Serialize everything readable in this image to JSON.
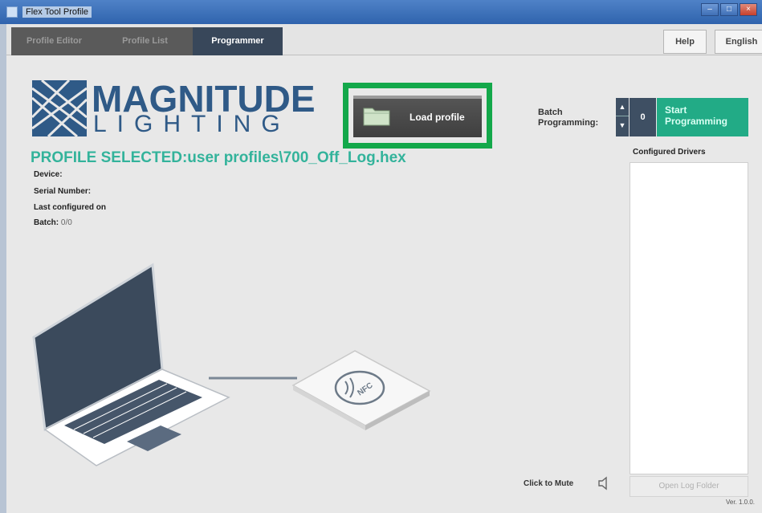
{
  "window": {
    "title": "Flex Tool Profile",
    "controls": [
      "–",
      "□",
      "×"
    ]
  },
  "tabs": [
    {
      "label": "Profile Editor",
      "active": false
    },
    {
      "label": "Profile List",
      "active": false
    },
    {
      "label": "Programmer",
      "active": true
    }
  ],
  "header": {
    "help_label": "Help",
    "language_label": "English"
  },
  "logo": {
    "line1": "MAGNITUDE",
    "line2": "LIGHTING"
  },
  "load_profile": {
    "label": "Load profile",
    "icon": "folder-icon"
  },
  "batch": {
    "label_line1": "Batch",
    "label_line2": "Programming:",
    "value": "0",
    "start_line1": "Start",
    "start_line2": "Programming"
  },
  "profile": {
    "selected_text": "PROFILE SELECTED:user profiles\\700_Off_Log.hex",
    "device_label": "Device:",
    "serial_label": "Serial Number:",
    "last_configured_label": "Last configured on",
    "batch_label": "Batch:",
    "batch_value": "0/0"
  },
  "drivers": {
    "title": "Configured Drivers",
    "open_log_label": "Open Log Folder"
  },
  "footer": {
    "mute_label": "Click to Mute",
    "version": "Ver. 1.0.0."
  },
  "illustration": {
    "nfc_label": "NFC"
  },
  "colors": {
    "accent_teal": "#33b39b",
    "start_green": "#22ab86",
    "highlight_green": "#13a84a",
    "brand_blue": "#2f5a87",
    "tab_active": "#38475a"
  }
}
